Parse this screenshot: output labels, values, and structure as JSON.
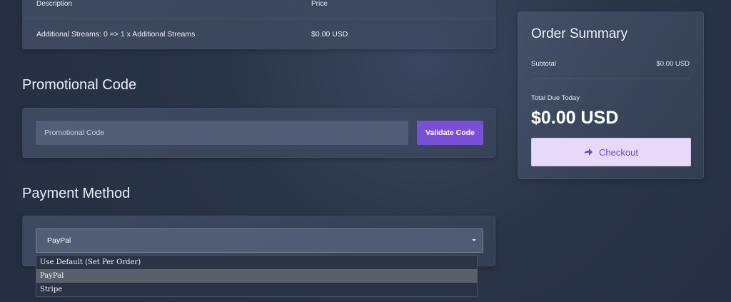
{
  "table": {
    "columns": [
      "Description",
      "Price"
    ],
    "rows": [
      {
        "description": "Additional Streams: 0 => 1 x Additional Streams",
        "price": "$0.00 USD"
      }
    ]
  },
  "promo": {
    "title": "Promotional Code",
    "input_placeholder": "Promotional Code",
    "input_value": "",
    "validate_label": "Validate Code"
  },
  "payment": {
    "title": "Payment Method",
    "selected": "PayPal",
    "options": [
      "Use Default (Set Per Order)",
      "PayPal",
      "Stripe"
    ]
  },
  "summary": {
    "title": "Order Summary",
    "subtotal_label": "Subtotal",
    "subtotal_value": "$0.00 USD",
    "total_label": "Total Due Today",
    "total_value": "$0.00 USD",
    "checkout_label": "Checkout",
    "checkout_icon": "arrow-right-icon"
  },
  "colors": {
    "accent": "#7a4fd8",
    "checkout_bg": "#e6daf8",
    "checkout_text": "#6e49c9"
  }
}
